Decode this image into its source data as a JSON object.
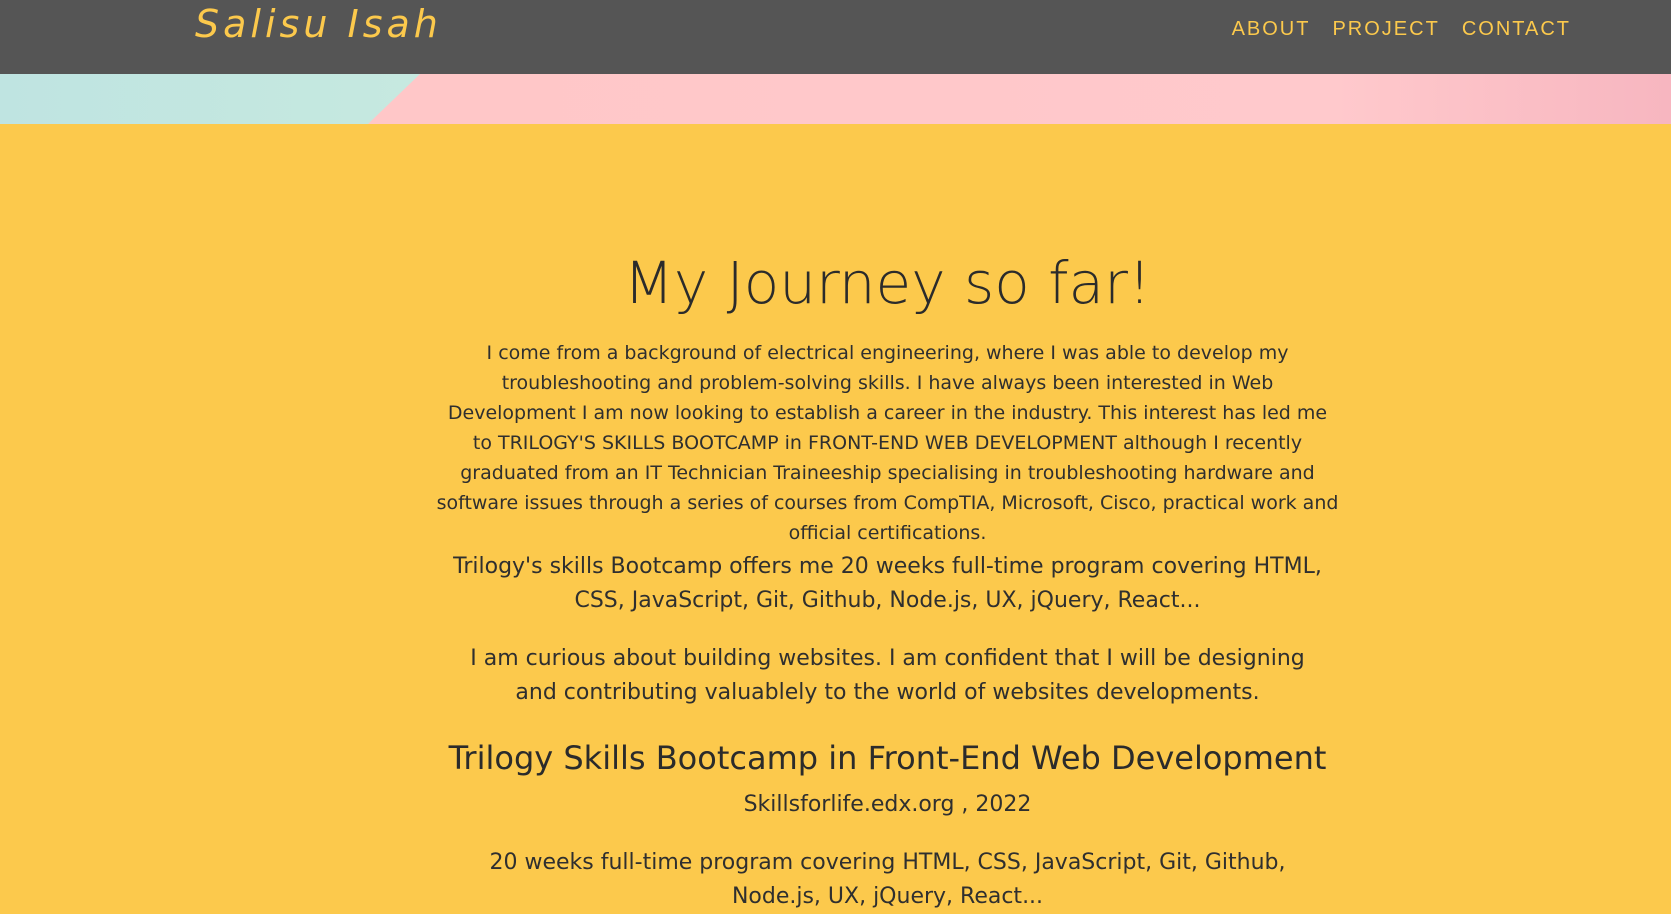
{
  "navbar": {
    "brand": "Salisu Isah",
    "links": [
      "ABOUT",
      "PROJECT",
      "CONTACT"
    ]
  },
  "main": {
    "heading": "My Journey so far!",
    "intro": "I come from a background of electrical engineering, where I was able to develop my troubleshooting and problem-solving skills. I have always been interested in Web Development I am now looking to establish a career in the industry. This interest has led me to TRILOGY'S SKILLS BOOTCAMP in FRONT-END WEB DEVELOPMENT although I recently graduated from an IT Technician Traineeship specialising in troubleshooting hardware and software issues through a series of courses from CompTIA, Microsoft, Cisco, practical work and official certifications.",
    "bootcamp_paragraph": "Trilogy's skills Bootcamp offers me 20 weeks full-time program covering HTML, CSS, JavaScript, Git, Github, Node.js, UX, jQuery, React...",
    "curiosity_paragraph": "I am curious about building websites. I am confident that I will be designing and contributing valuablely to the world of websites developments.",
    "course_title": "Trilogy Skills Bootcamp in Front-End Web Development",
    "course_provider": "Skillsforlife.edx.org , 2022",
    "course_description": "20 weeks full-time program covering HTML, CSS, JavaScript, Git, Github, Node.js, UX, jQuery, React..."
  },
  "colors": {
    "navbar_bg": "#555555",
    "accent_yellow": "#fcc94c",
    "banner_pink": "#ffc6c6",
    "banner_mint": "#bfe4e1",
    "text_dark": "#2b2b2b"
  }
}
